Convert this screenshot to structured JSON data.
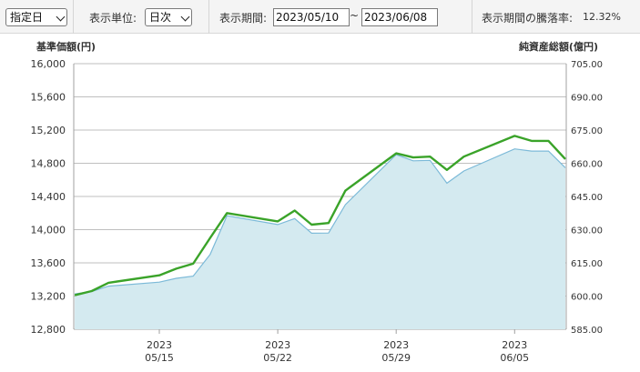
{
  "toolbar": {
    "reference_select": "指定日",
    "unit_label": "表示単位:",
    "unit_select": "日次",
    "period_label": "表示期間:",
    "date_from": "2023/05/10",
    "separator": "~",
    "date_to": "2023/06/08",
    "rate_label": "表示期間の騰落率:",
    "rate_value": "12.32%"
  },
  "colors": {
    "nav_line": "#3aa329",
    "area_fill": "#d4eaf0",
    "area_stroke": "#7cbad8",
    "grid": "#bfbfbf"
  },
  "chart_data": {
    "type": "line",
    "left_axis_title": "基準価額(円)",
    "right_axis_title": "純資産総額(億円)",
    "left_ylim": [
      12800,
      16000
    ],
    "right_ylim": [
      585,
      705
    ],
    "left_ticks": [
      "16,000",
      "15,600",
      "15,200",
      "14,800",
      "14,400",
      "14,000",
      "13,600",
      "13,200",
      "12,800"
    ],
    "right_ticks": [
      "705.00",
      "690.00",
      "675.00",
      "660.00",
      "645.00",
      "630.00",
      "615.00",
      "600.00",
      "585.00"
    ],
    "x_tick_labels": [
      {
        "year": "2023",
        "date": "05/15"
      },
      {
        "year": "2023",
        "date": "05/22"
      },
      {
        "year": "2023",
        "date": "05/29"
      },
      {
        "year": "2023",
        "date": "06/05"
      }
    ],
    "x_tick_dates": [
      "2023-05-15",
      "2023-05-22",
      "2023-05-29",
      "2023-06-05"
    ],
    "series": [
      {
        "name": "基準価額",
        "axis": "left",
        "type": "line",
        "points": [
          [
            "2023-05-10",
            13210
          ],
          [
            "2023-05-11",
            13260
          ],
          [
            "2023-05-12",
            13360
          ],
          [
            "2023-05-15",
            13450
          ],
          [
            "2023-05-16",
            13530
          ],
          [
            "2023-05-17",
            13590
          ],
          [
            "2023-05-18",
            13900
          ],
          [
            "2023-05-19",
            14200
          ],
          [
            "2023-05-22",
            14100
          ],
          [
            "2023-05-23",
            14230
          ],
          [
            "2023-05-24",
            14060
          ],
          [
            "2023-05-25",
            14080
          ],
          [
            "2023-05-26",
            14470
          ],
          [
            "2023-05-29",
            14920
          ],
          [
            "2023-05-30",
            14870
          ],
          [
            "2023-05-31",
            14880
          ],
          [
            "2023-06-01",
            14720
          ],
          [
            "2023-06-02",
            14880
          ],
          [
            "2023-06-05",
            15130
          ],
          [
            "2023-06-06",
            15070
          ],
          [
            "2023-06-07",
            15070
          ],
          [
            "2023-06-08",
            14850
          ]
        ]
      },
      {
        "name": "純資産総額",
        "axis": "right",
        "type": "area",
        "points": [
          [
            "2023-05-10",
            601.0
          ],
          [
            "2023-05-11",
            602.0
          ],
          [
            "2023-05-12",
            604.5
          ],
          [
            "2023-05-15",
            606.3
          ],
          [
            "2023-05-16",
            608.0
          ],
          [
            "2023-05-17",
            609.0
          ],
          [
            "2023-05-18",
            618.8
          ],
          [
            "2023-05-19",
            636.3
          ],
          [
            "2023-05-22",
            632.3
          ],
          [
            "2023-05-23",
            635.0
          ],
          [
            "2023-05-24",
            628.4
          ],
          [
            "2023-05-25",
            628.5
          ],
          [
            "2023-05-26",
            641.3
          ],
          [
            "2023-05-29",
            663.9
          ],
          [
            "2023-05-30",
            661.1
          ],
          [
            "2023-05-31",
            661.3
          ],
          [
            "2023-06-01",
            651.0
          ],
          [
            "2023-06-02",
            656.5
          ],
          [
            "2023-06-05",
            666.5
          ],
          [
            "2023-06-06",
            665.5
          ],
          [
            "2023-06-07",
            665.5
          ],
          [
            "2023-06-08",
            658.0
          ]
        ]
      }
    ]
  }
}
